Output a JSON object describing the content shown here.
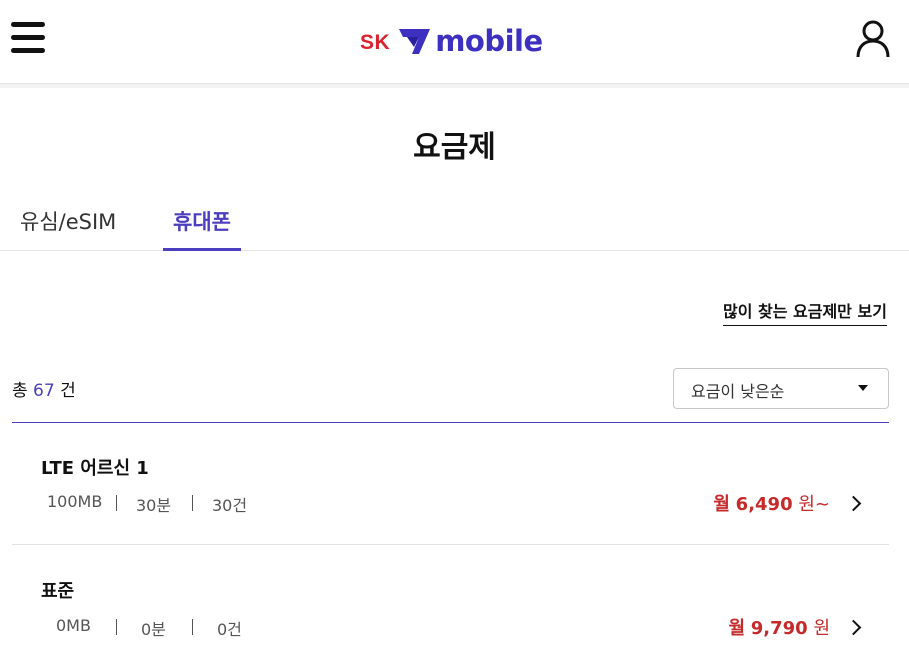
{
  "header": {
    "logo_sk": "SK",
    "logo_word": "mobile",
    "brand_red": "#d9232f",
    "brand_purple": "#3d2fbf",
    "menu_icon": "hamburger-menu-icon",
    "user_icon": "user-icon"
  },
  "page": {
    "title": "요금제"
  },
  "tabs": [
    {
      "label": "유심/eSIM",
      "active": false
    },
    {
      "label": "휴대폰",
      "active": true
    }
  ],
  "filter": {
    "popular_link": "많이 찾는 요금제만 보기"
  },
  "summary": {
    "prefix": "총",
    "count": "67",
    "suffix": "건"
  },
  "sort": {
    "selected": "요금이 낮은순"
  },
  "plans": [
    {
      "name": "LTE 어르신 1",
      "data": "100MB",
      "voice": "30분",
      "sms": "30건",
      "price_prefix": "월",
      "price": "6,490",
      "price_unit": "원~"
    },
    {
      "name": "표준",
      "data": "0MB",
      "voice": "0분",
      "sms": "0건",
      "price_prefix": "월",
      "price": "9,790",
      "price_unit": "원"
    }
  ],
  "colors": {
    "accent": "#4b3fbf",
    "price": "#c62a2a"
  }
}
